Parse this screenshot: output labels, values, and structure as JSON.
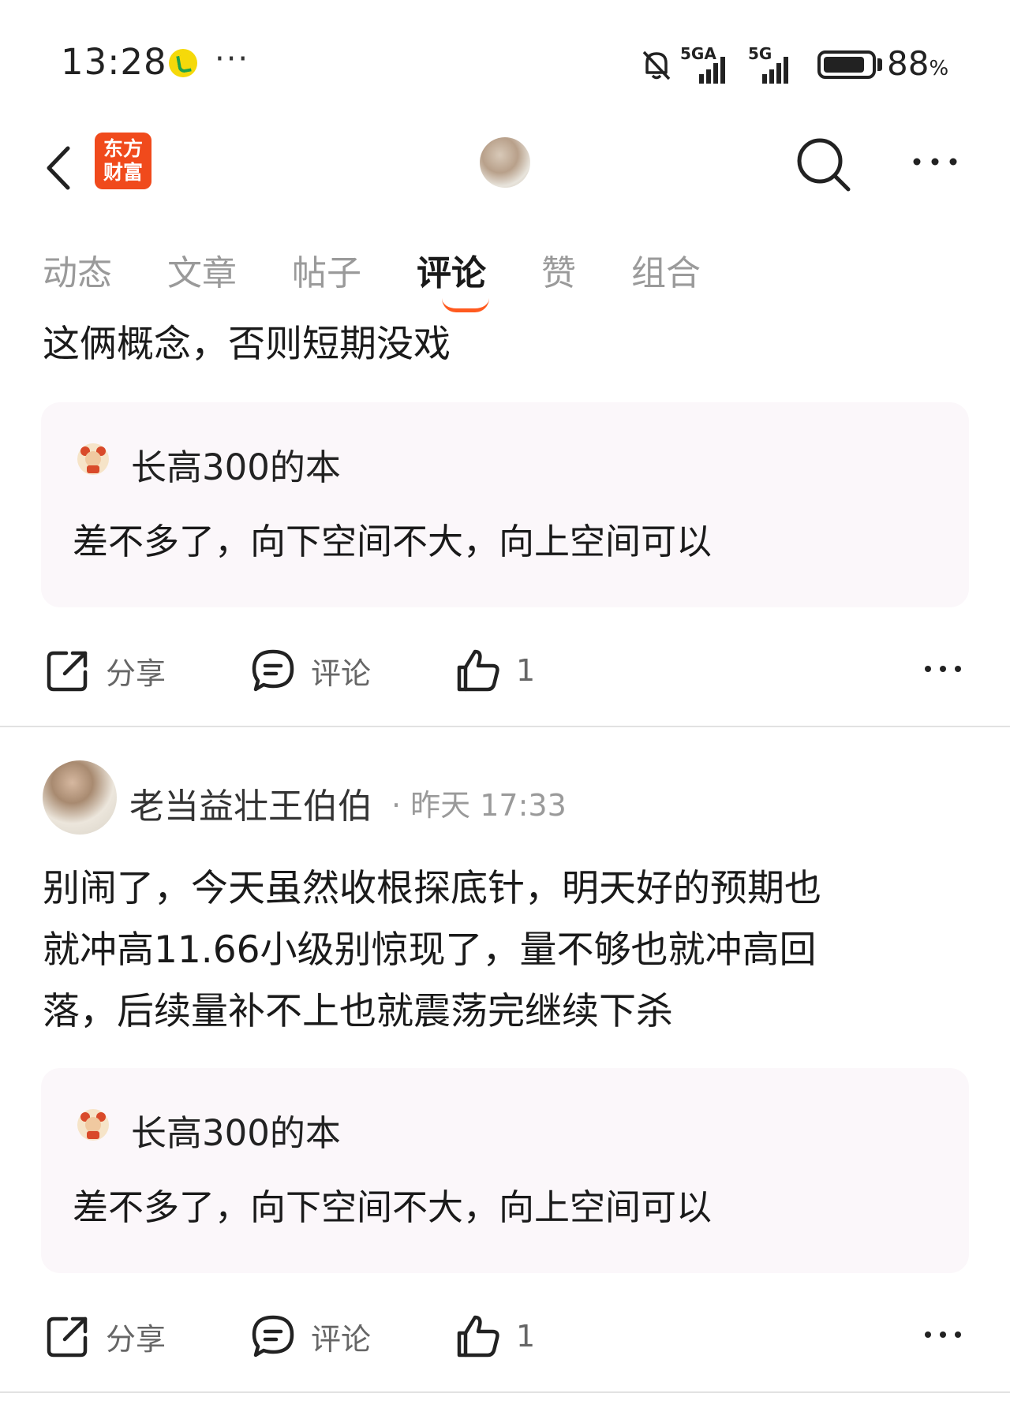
{
  "status_bar": {
    "time": "13:28",
    "more": "···",
    "network1": "5GA",
    "network2": "5G",
    "battery_value": "88",
    "battery_unit": "%",
    "battery_level": 0.88
  },
  "header": {
    "logo_text_line1": "东方",
    "logo_text_line2": "财富"
  },
  "tabs": [
    {
      "label": "动态"
    },
    {
      "label": "文章"
    },
    {
      "label": "帖子"
    },
    {
      "label": "评论"
    },
    {
      "label": "赞"
    },
    {
      "label": "组合"
    }
  ],
  "active_tab": "评论",
  "posts": [
    {
      "text": "这俩概念，否则短期没戏",
      "quote": {
        "author": "长高300的本",
        "text": "差不多了，向下空间不大，向上空间可以"
      },
      "actions": {
        "share": "分享",
        "comment": "评论",
        "likes": "1"
      }
    },
    {
      "author": "老当益壮王伯伯",
      "time": "· 昨天 17:33",
      "text_lines": [
        "别闹了，今天虽然收根探底针，明天好的预期也",
        "就冲高11.66小级别惊现了，量不够也就冲高回",
        "落，后续量补不上也就震荡完继续下杀"
      ],
      "quote": {
        "author": "长高300的本",
        "text": "差不多了，向下空间不大，向上空间可以"
      },
      "actions": {
        "share": "分享",
        "comment": "评论",
        "likes": "1"
      }
    }
  ],
  "colors": {
    "accent": "#ff5a1f",
    "logo_bg": "#f04a1c",
    "quote_bg": "#fbf7fa"
  }
}
